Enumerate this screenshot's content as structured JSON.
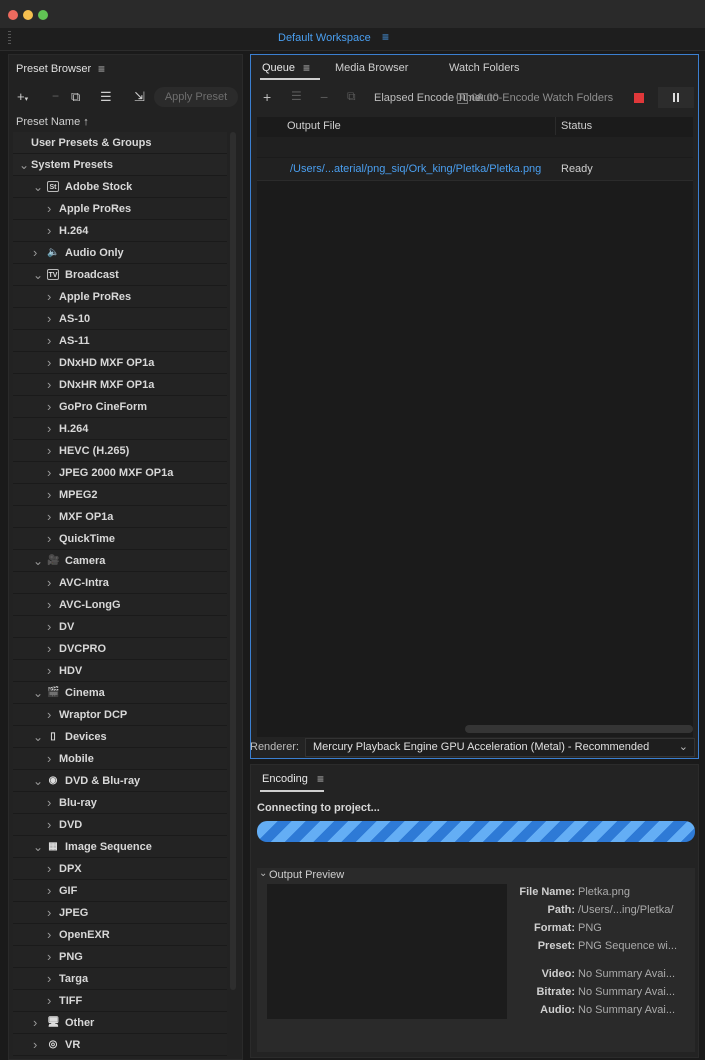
{
  "workspace": {
    "name": "Default Workspace"
  },
  "preset_browser": {
    "title": "Preset Browser",
    "apply_preset": "Apply Preset",
    "column_header": "Preset Name",
    "rows": [
      {
        "level": 0,
        "label": "User Presets & Groups",
        "chev": "",
        "icon": ""
      },
      {
        "level": 0,
        "label": "System Presets",
        "chev": "v",
        "icon": ""
      },
      {
        "level": 1,
        "label": "Adobe Stock",
        "chev": "v",
        "icon": "St"
      },
      {
        "level": 2,
        "label": "Apple ProRes",
        "chev": ">",
        "icon": ""
      },
      {
        "level": 2,
        "label": "H.264",
        "chev": ">",
        "icon": ""
      },
      {
        "level": 1,
        "label": "Audio Only",
        "chev": ">",
        "icon": "speaker"
      },
      {
        "level": 1,
        "label": "Broadcast",
        "chev": "v",
        "icon": "TV"
      },
      {
        "level": 2,
        "label": "Apple ProRes",
        "chev": ">",
        "icon": ""
      },
      {
        "level": 2,
        "label": "AS-10",
        "chev": ">",
        "icon": ""
      },
      {
        "level": 2,
        "label": "AS-11",
        "chev": ">",
        "icon": ""
      },
      {
        "level": 2,
        "label": "DNxHD MXF OP1a",
        "chev": ">",
        "icon": ""
      },
      {
        "level": 2,
        "label": "DNxHR MXF OP1a",
        "chev": ">",
        "icon": ""
      },
      {
        "level": 2,
        "label": "GoPro CineForm",
        "chev": ">",
        "icon": ""
      },
      {
        "level": 2,
        "label": "H.264",
        "chev": ">",
        "icon": ""
      },
      {
        "level": 2,
        "label": "HEVC (H.265)",
        "chev": ">",
        "icon": ""
      },
      {
        "level": 2,
        "label": "JPEG 2000 MXF OP1a",
        "chev": ">",
        "icon": ""
      },
      {
        "level": 2,
        "label": "MPEG2",
        "chev": ">",
        "icon": ""
      },
      {
        "level": 2,
        "label": "MXF OP1a",
        "chev": ">",
        "icon": ""
      },
      {
        "level": 2,
        "label": "QuickTime",
        "chev": ">",
        "icon": ""
      },
      {
        "level": 1,
        "label": "Camera",
        "chev": "v",
        "icon": "camera"
      },
      {
        "level": 2,
        "label": "AVC-Intra",
        "chev": ">",
        "icon": ""
      },
      {
        "level": 2,
        "label": "AVC-LongG",
        "chev": ">",
        "icon": ""
      },
      {
        "level": 2,
        "label": "DV",
        "chev": ">",
        "icon": ""
      },
      {
        "level": 2,
        "label": "DVCPRO",
        "chev": ">",
        "icon": ""
      },
      {
        "level": 2,
        "label": "HDV",
        "chev": ">",
        "icon": ""
      },
      {
        "level": 1,
        "label": "Cinema",
        "chev": "v",
        "icon": "film"
      },
      {
        "level": 2,
        "label": "Wraptor DCP",
        "chev": ">",
        "icon": ""
      },
      {
        "level": 1,
        "label": "Devices",
        "chev": "v",
        "icon": "phone"
      },
      {
        "level": 2,
        "label": "Mobile",
        "chev": ">",
        "icon": ""
      },
      {
        "level": 1,
        "label": "DVD & Blu-ray",
        "chev": "v",
        "icon": "disc"
      },
      {
        "level": 2,
        "label": "Blu-ray",
        "chev": ">",
        "icon": ""
      },
      {
        "level": 2,
        "label": "DVD",
        "chev": ">",
        "icon": ""
      },
      {
        "level": 1,
        "label": "Image Sequence",
        "chev": "v",
        "icon": "filmstrip"
      },
      {
        "level": 2,
        "label": "DPX",
        "chev": ">",
        "icon": ""
      },
      {
        "level": 2,
        "label": "GIF",
        "chev": ">",
        "icon": ""
      },
      {
        "level": 2,
        "label": "JPEG",
        "chev": ">",
        "icon": ""
      },
      {
        "level": 2,
        "label": "OpenEXR",
        "chev": ">",
        "icon": ""
      },
      {
        "level": 2,
        "label": "PNG",
        "chev": ">",
        "icon": ""
      },
      {
        "level": 2,
        "label": "Targa",
        "chev": ">",
        "icon": ""
      },
      {
        "level": 2,
        "label": "TIFF",
        "chev": ">",
        "icon": ""
      },
      {
        "level": 1,
        "label": "Other",
        "chev": ">",
        "icon": "monitor"
      },
      {
        "level": 1,
        "label": "VR",
        "chev": ">",
        "icon": "vr"
      }
    ]
  },
  "queue": {
    "tabs": [
      "Queue",
      "Media Browser",
      "Watch Folders"
    ],
    "elapsed_label": "Elapsed Encode Time:",
    "elapsed_value": "00:00:00",
    "auto_encode_label": "Auto-Encode Watch Folders",
    "col_output": "Output File",
    "col_status": "Status",
    "item": {
      "path": "/Users/...aterial/png_siq/Ork_king/Pletka/Pletka.png",
      "status": "Ready"
    },
    "renderer_label": "Renderer:",
    "renderer_value": "Mercury Playback Engine GPU Acceleration (Metal) - Recommended"
  },
  "encoding": {
    "title": "Encoding",
    "status": "Connecting to project...",
    "output_preview_title": "Output Preview",
    "props": [
      {
        "k": "File Name:",
        "v": "Pletka.png"
      },
      {
        "k": "Path:",
        "v": "/Users/...ing/Pletka/"
      },
      {
        "k": "Format:",
        "v": "PNG"
      },
      {
        "k": "Preset:",
        "v": "PNG Sequence wi..."
      },
      {
        "k": "Video:",
        "v": "No Summary Avai..."
      },
      {
        "k": "Bitrate:",
        "v": "No Summary Avai..."
      },
      {
        "k": "Audio:",
        "v": "No Summary Avai..."
      }
    ]
  },
  "colors": {
    "accent": "#4a9ff0",
    "stop": "#e0383a",
    "panel": "#232323"
  }
}
